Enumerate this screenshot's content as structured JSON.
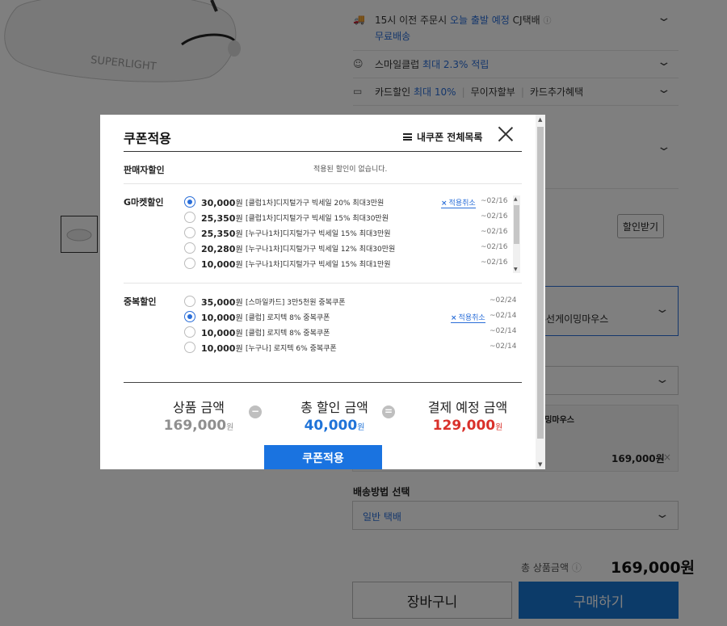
{
  "background": {
    "product_badge": "SUPERLIGHT",
    "delivery": {
      "time": "15시 이전 주문시",
      "today": "오늘 출발 예정",
      "carrier": "CJ택배",
      "free": "무료배송"
    },
    "smile_club": {
      "label": "스마일클럽",
      "rate": "최대 2.3% 적립"
    },
    "card": {
      "label": "카드할인",
      "rate": "최대 10%",
      "installment": "무이자할부",
      "extra": "카드추가혜택"
    },
    "discount_button": "할인받기",
    "option_text": "무선게이밍마우스",
    "option_card": {
      "name": "이밍마우스",
      "price": "169,000원"
    },
    "shipping": {
      "label": "배송방법 선택",
      "value": "일반 택배"
    },
    "total": {
      "label": "총 상품금액",
      "price": "169,000원"
    },
    "cart_button": "장바구니",
    "buy_button": "구매하기"
  },
  "modal": {
    "title": "쿠폰적용",
    "my_coupons": "내쿠폰 전체목록",
    "seller_section": {
      "label": "판매자할인",
      "empty": "적용된 할인이 없습니다."
    },
    "gmarket_section": {
      "label": "G마켓할인",
      "coupons": [
        {
          "amount": "30,000",
          "won": "원",
          "name": "[클럽1차]디지털가구 빅세일 20% 최대3만원",
          "date": "~02/16",
          "selected": true,
          "cancel": "적용취소"
        },
        {
          "amount": "25,350",
          "won": "원",
          "name": "[클럽1차]디지털가구 빅세일 15% 최대30만원",
          "date": "~02/16",
          "selected": false
        },
        {
          "amount": "25,350",
          "won": "원",
          "name": "[누구나1차]디지털가구 빅세일 15% 최대3만원",
          "date": "~02/16",
          "selected": false
        },
        {
          "amount": "20,280",
          "won": "원",
          "name": "[누구나1차]디지털가구 빅세일 12% 최대30만원",
          "date": "~02/16",
          "selected": false
        },
        {
          "amount": "10,000",
          "won": "원",
          "name": "[누구나1차]디지털가구 빅세일 15% 최대1만원",
          "date": "~02/16",
          "selected": false
        }
      ]
    },
    "dup_section": {
      "label": "중복할인",
      "coupons": [
        {
          "amount": "35,000",
          "won": "원",
          "name": "[스마일카드] 3만5천원 중복쿠폰",
          "date": "~02/24",
          "selected": false
        },
        {
          "amount": "10,000",
          "won": "원",
          "name": "[클럽] 로지텍 8% 중복쿠폰",
          "date": "~02/14",
          "selected": true,
          "cancel": "적용취소"
        },
        {
          "amount": "10,000",
          "won": "원",
          "name": "[클럽] 로지텍 8% 중복쿠폰",
          "date": "~02/14",
          "selected": false
        },
        {
          "amount": "10,000",
          "won": "원",
          "name": "[누구나] 로지텍 6% 중복쿠폰",
          "date": "~02/14",
          "selected": false
        }
      ]
    },
    "summary": {
      "product": {
        "label": "상품 금액",
        "value": "169,000",
        "won": "원"
      },
      "discount": {
        "label": "총 할인 금액",
        "value": "40,000",
        "won": "원"
      },
      "payment": {
        "label": "결제 예정 금액",
        "value": "129,000",
        "won": "원"
      },
      "minus": "−",
      "equals": "="
    },
    "apply_button": "쿠폰적용"
  },
  "colors": {
    "accent": "#1a73e0",
    "discount_blue": "#1f73d8",
    "payment_red": "#d9302a",
    "product_gray": "#8f8f8f"
  }
}
